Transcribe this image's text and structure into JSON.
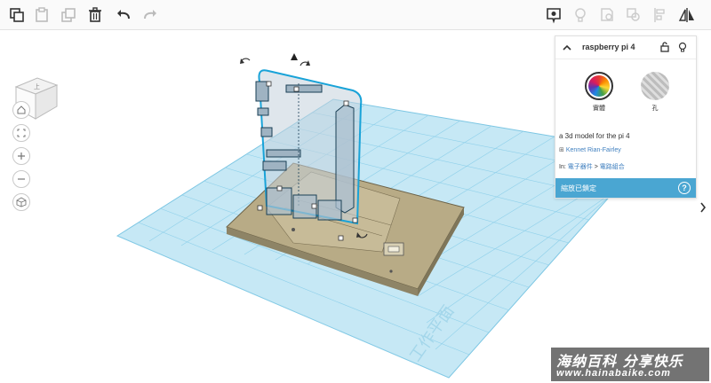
{
  "toolbar": {
    "left_tools": [
      "copy-icon",
      "paste-icon",
      "duplicate-icon",
      "trash-icon",
      "undo-icon",
      "redo-icon"
    ],
    "right_tools": [
      "notes-icon",
      "light-bulb-icon",
      "group-icon",
      "ungroup-icon",
      "align-icon",
      "mirror-icon"
    ]
  },
  "viewcube": {
    "face_label": "上"
  },
  "inspector": {
    "title": "raspberry pi 4",
    "solid_label": "實體",
    "hole_label": "孔",
    "description": "a 3d model for the pi 4",
    "author": "Kennet Rian-Fairley",
    "category_prefix": "In:",
    "category": "電子器件",
    "category_sep": ">",
    "subcategory": "電路組合",
    "scale_locked": "縮放已鎖定",
    "help": "?"
  },
  "canvas": {
    "grid_watermark": "工作平面"
  },
  "watermark": {
    "line1": "海纳百科 分享快乐",
    "line2": "www.hainabaike.com"
  },
  "colors": {
    "accent": "#4aa6d2",
    "grid": "#bfe3f2",
    "grid_line": "#8fd0ea",
    "board": "#b8ab86",
    "selection": "#19a3d8"
  }
}
